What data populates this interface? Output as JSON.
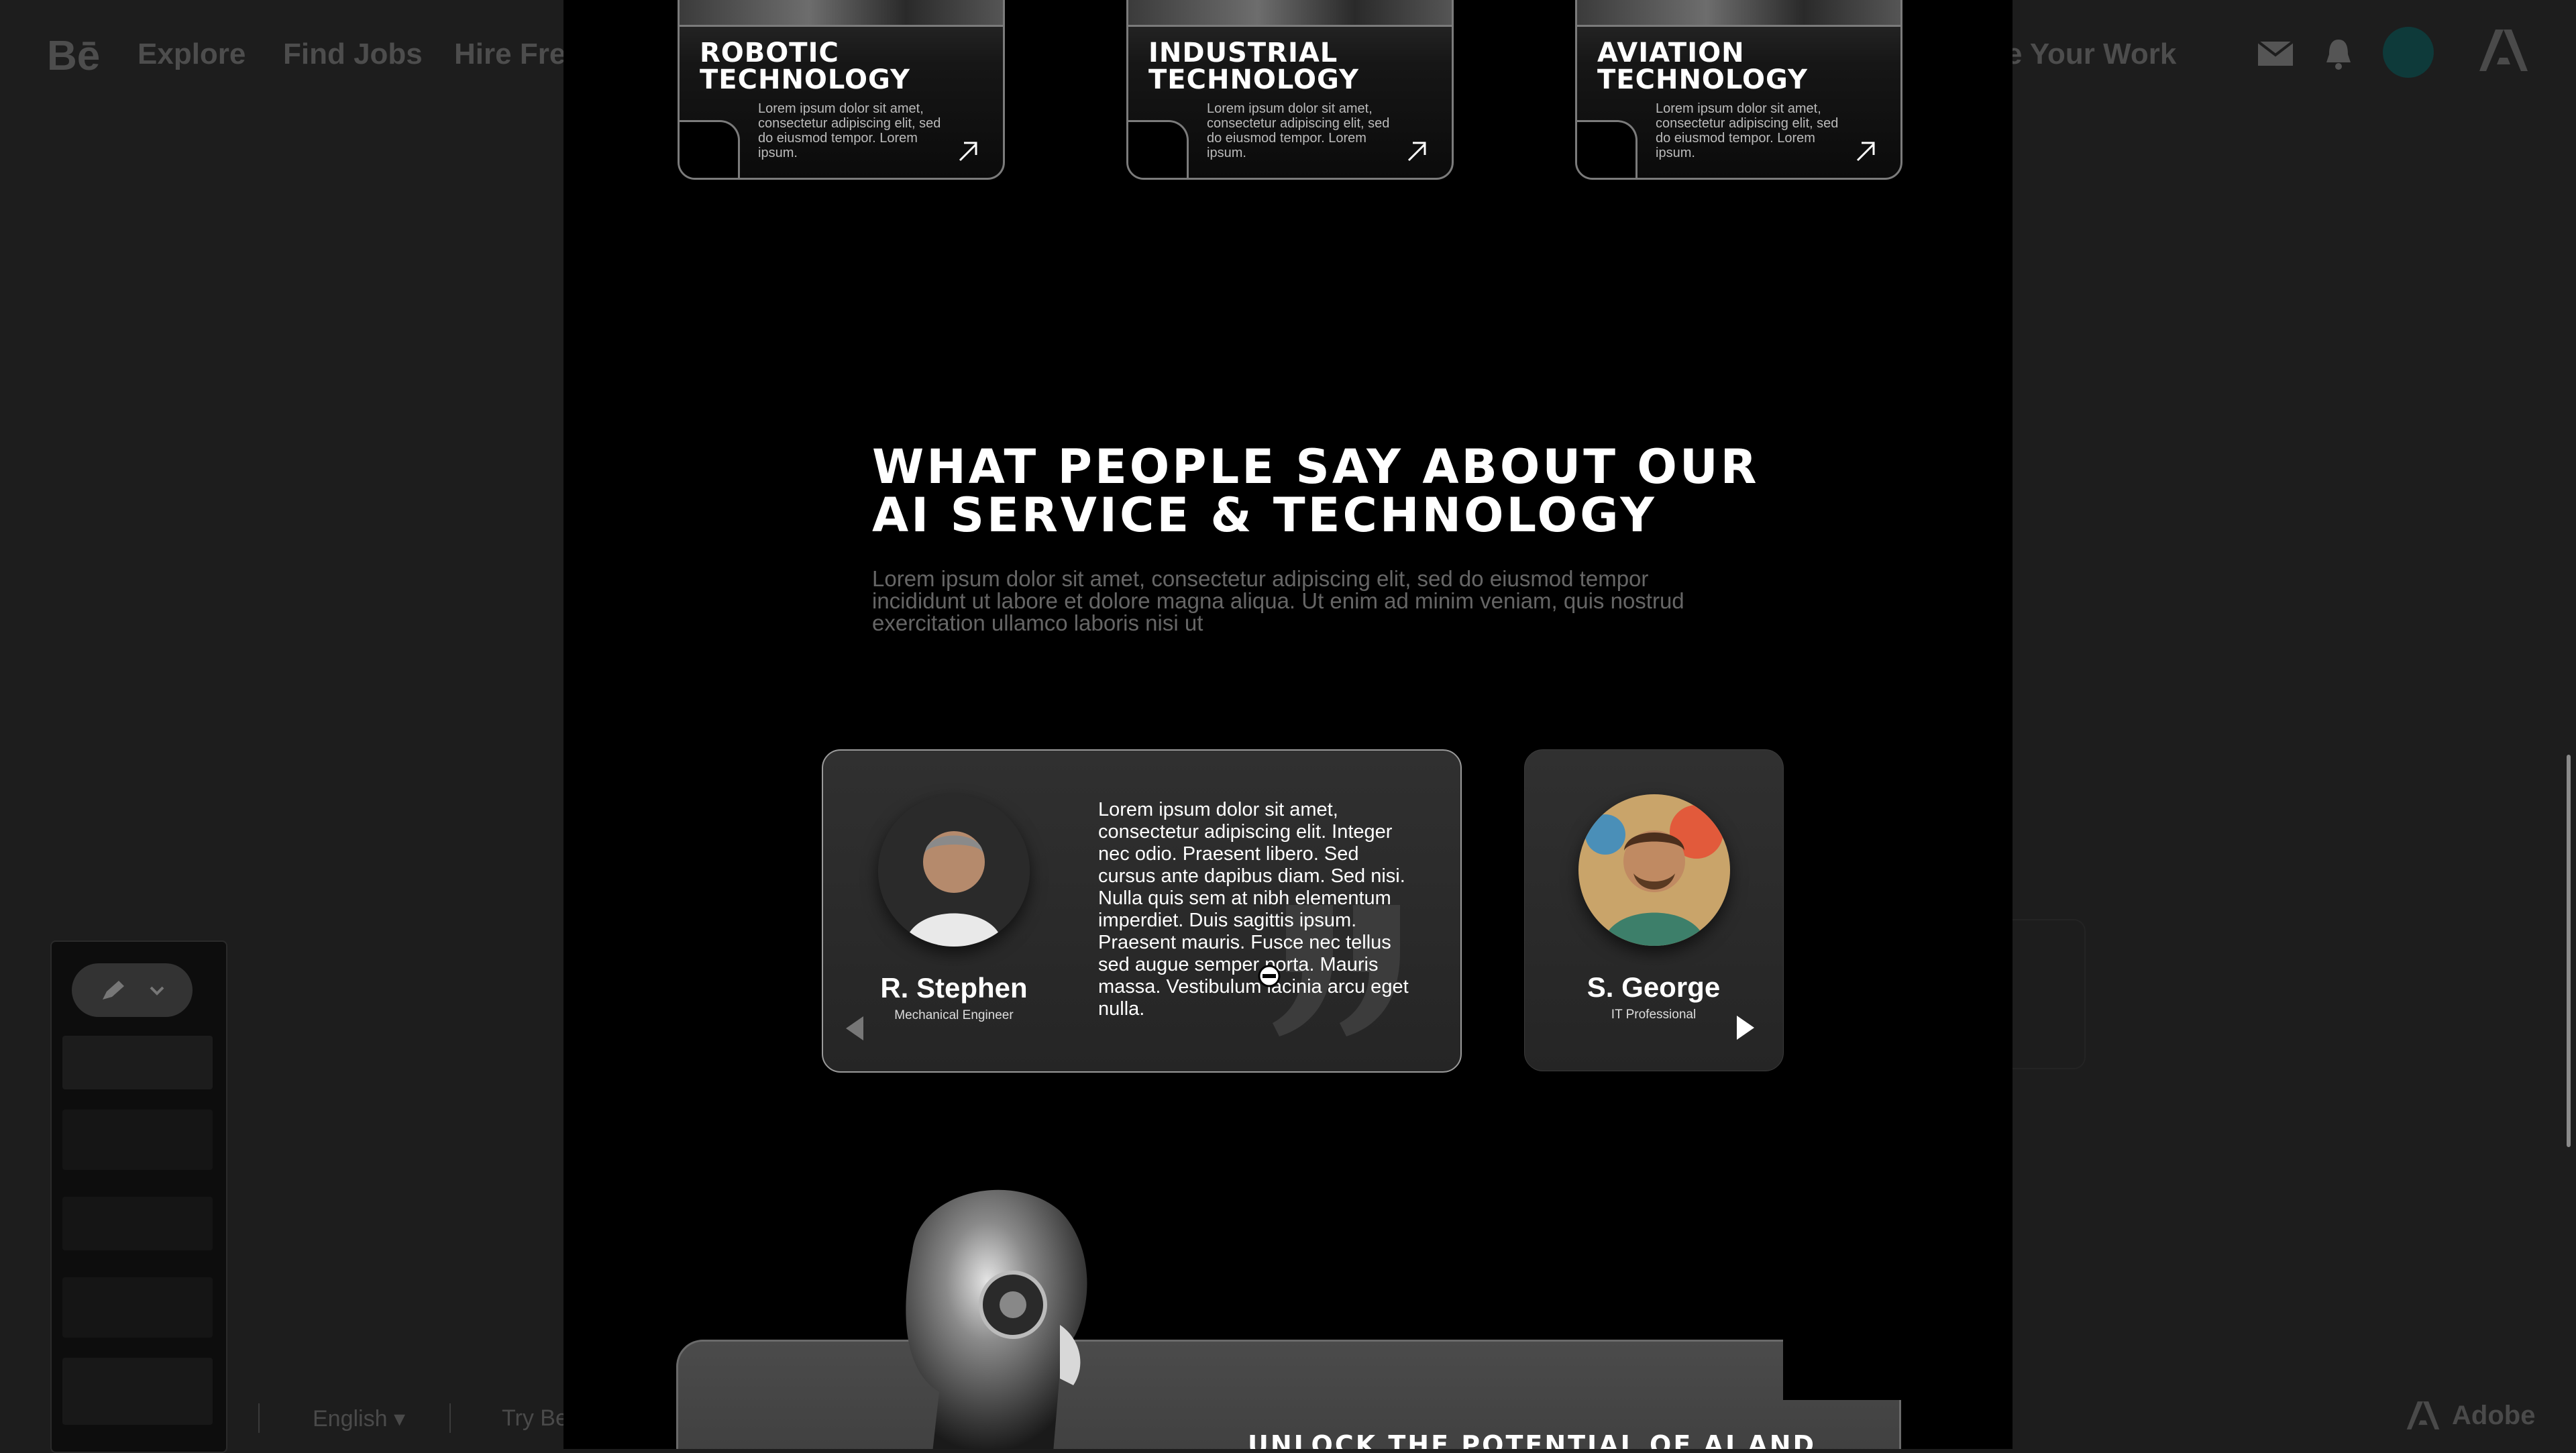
{
  "behance_header": {
    "logo": "Bē",
    "nav": [
      "Explore",
      "Find Jobs",
      "Hire Fre"
    ],
    "share_partial": "e Your Work",
    "icons": [
      "mail-icon",
      "bell-icon",
      "user-avatar",
      "adobe-logo-icon"
    ]
  },
  "footer": {
    "language": "English",
    "try_partial": "Try Be",
    "brand": "Adobe"
  },
  "project": {
    "tech_cards": [
      {
        "title_line1": "ROBOTIC",
        "title_line2": "TECHNOLOGY",
        "desc": "Lorem ipsum dolor sit amet, consectetur adipiscing elit, sed do eiusmod tempor. Lorem ipsum."
      },
      {
        "title_line1": "INDUSTRIAL",
        "title_line2": "TECHNOLOGY",
        "desc": "Lorem ipsum dolor sit amet, consectetur adipiscing elit, sed do eiusmod tempor. Lorem ipsum."
      },
      {
        "title_line1": "AVIATION",
        "title_line2": "TECHNOLOGY",
        "desc": "Lorem ipsum dolor sit amet, consectetur adipiscing elit, sed do eiusmod tempor. Lorem ipsum."
      }
    ],
    "testimonials_heading_line1": "WHAT PEOPLE SAY ABOUT OUR",
    "testimonials_heading_line2": "AI SERVICE & TECHNOLOGY",
    "testimonials_sub": "Lorem ipsum dolor sit amet, consectetur adipiscing elit, sed do eiusmod tempor incididunt ut labore et dolore magna aliqua. Ut enim ad minim veniam, quis nostrud exercitation ullamco laboris nisi ut",
    "testimonials": [
      {
        "name": "R. Stephen",
        "role": "Mechanical Engineer",
        "quote": "Lorem ipsum dolor sit amet, consectetur adipiscing elit. Integer nec odio. Praesent libero. Sed cursus ante dapibus diam. Sed nisi. Nulla quis sem at nibh elementum imperdiet. Duis sagittis ipsum. Praesent mauris. Fusce nec tellus sed augue semper porta. Mauris massa. Vestibulum lacinia arcu eget nulla."
      },
      {
        "name": "S. George",
        "role": "IT Professional"
      }
    ],
    "cta_title": "UNLOCK THE POTENTIAL OF AI AND"
  },
  "colors": {
    "canvas_bg": "#000000",
    "page_bg": "#1d1d1d",
    "card_bg": "#2b2b2b",
    "card_border": "#9a9a9a",
    "muted_text": "#666666"
  }
}
